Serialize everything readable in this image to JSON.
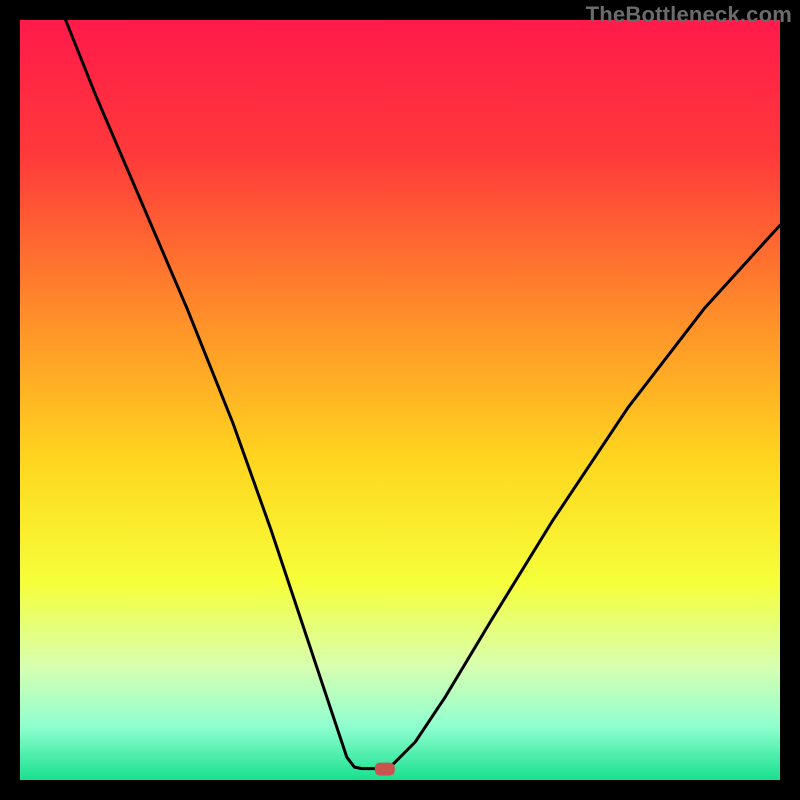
{
  "watermark": "TheBottleneck.com",
  "chart_data": {
    "type": "line",
    "xlim": [
      0,
      100
    ],
    "ylim": [
      0,
      100
    ],
    "title": "",
    "xlabel": "",
    "ylabel": "",
    "background_gradient": {
      "stops": [
        {
          "offset": 0.0,
          "color": "#ff1a4b"
        },
        {
          "offset": 0.18,
          "color": "#ff3a3a"
        },
        {
          "offset": 0.38,
          "color": "#ff8a2a"
        },
        {
          "offset": 0.58,
          "color": "#ffd61f"
        },
        {
          "offset": 0.74,
          "color": "#f6ff3a"
        },
        {
          "offset": 0.85,
          "color": "#d8ffb0"
        },
        {
          "offset": 0.93,
          "color": "#8fffd0"
        },
        {
          "offset": 1.0,
          "color": "#18e08e"
        }
      ]
    },
    "curve": [
      {
        "x": 6,
        "y": 100
      },
      {
        "x": 10,
        "y": 90
      },
      {
        "x": 16,
        "y": 76
      },
      {
        "x": 22,
        "y": 62
      },
      {
        "x": 28,
        "y": 47
      },
      {
        "x": 33,
        "y": 33
      },
      {
        "x": 37,
        "y": 21
      },
      {
        "x": 40,
        "y": 12
      },
      {
        "x": 42,
        "y": 6
      },
      {
        "x": 43,
        "y": 3
      },
      {
        "x": 44,
        "y": 1.7
      },
      {
        "x": 45,
        "y": 1.5
      },
      {
        "x": 47,
        "y": 1.5
      },
      {
        "x": 48,
        "y": 1.5
      },
      {
        "x": 49,
        "y": 2
      },
      {
        "x": 52,
        "y": 5
      },
      {
        "x": 56,
        "y": 11
      },
      {
        "x": 62,
        "y": 21
      },
      {
        "x": 70,
        "y": 34
      },
      {
        "x": 80,
        "y": 49
      },
      {
        "x": 90,
        "y": 62
      },
      {
        "x": 100,
        "y": 73
      }
    ],
    "marker": {
      "x": 48,
      "y": 1.5,
      "color": "#c9534f"
    }
  }
}
